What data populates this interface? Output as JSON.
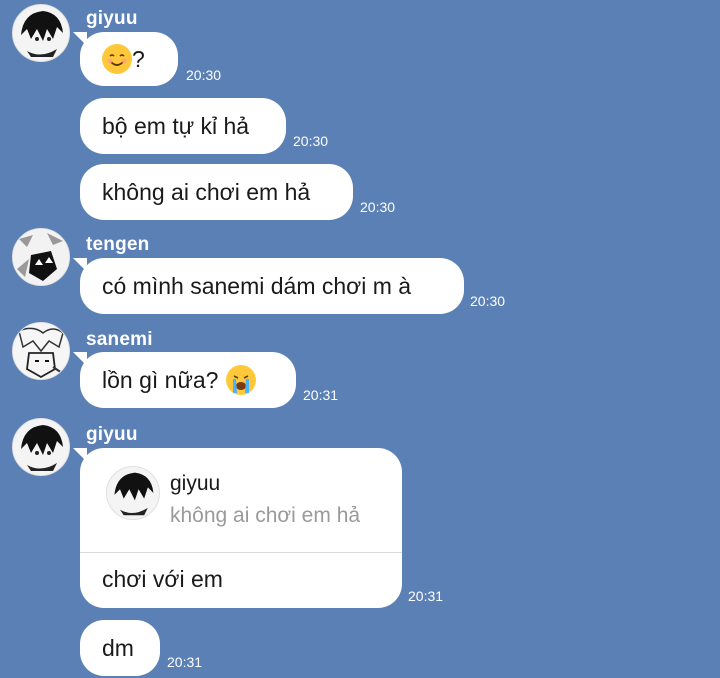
{
  "messages": [
    {
      "sender": "giyuu",
      "text": "?",
      "emoji": "smiling-face-icon",
      "time": "20:30"
    },
    {
      "text": "bộ em tự kỉ hả",
      "time": "20:30"
    },
    {
      "text": "không ai chơi em hả",
      "time": "20:30"
    },
    {
      "sender": "tengen",
      "text": "có mình sanemi dám chơi m à",
      "time": "20:30"
    },
    {
      "sender": "sanemi",
      "text": "lồn gì nữa?",
      "emoji": "loudly-crying-face-icon",
      "time": "20:31"
    },
    {
      "sender": "giyuu",
      "quote": {
        "name": "giyuu",
        "text": "không ai chơi em hả"
      },
      "text": "chơi với em",
      "time": "20:31"
    },
    {
      "text": "dm",
      "time": "20:31"
    }
  ],
  "colors": {
    "background": "#5a80b6",
    "bubble": "#ffffff",
    "time_text": "#ffffff"
  }
}
